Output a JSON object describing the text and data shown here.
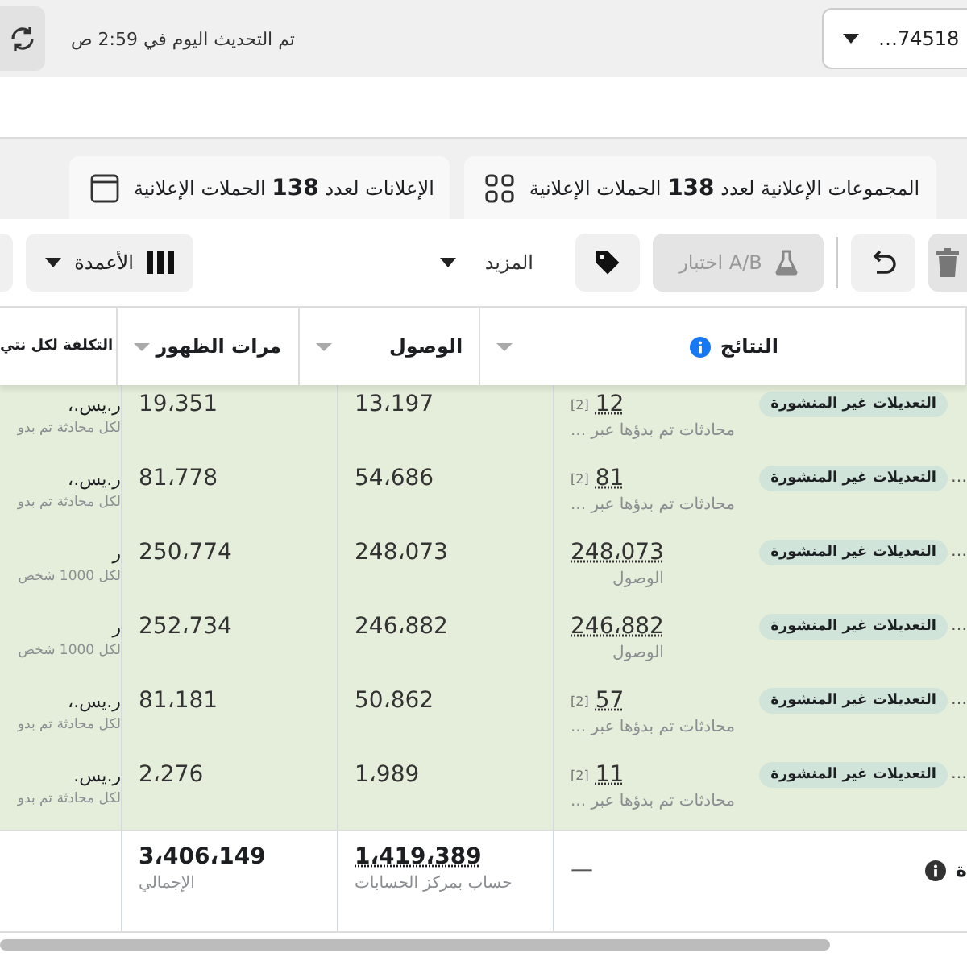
{
  "topbar": {
    "updated": "تم التحديث اليوم في 2:59 ص",
    "account": "…74518"
  },
  "tabs": [
    {
      "label": "المجموعات الإعلانية لعدد **138** الحملات الإعلانية",
      "kind": "grid",
      "selected": false
    },
    {
      "label": "الإعلانات لعدد **138** الحملات الإعلانية",
      "kind": "window",
      "selected": false
    }
  ],
  "toolbar": {
    "columns": "الأعمدة",
    "more": "المزيد",
    "ab_test": {
      "label": "اختبار A/B",
      "disabled": true
    }
  },
  "table": {
    "columns": [
      {
        "label": "النتائج",
        "info": true
      },
      {
        "label": "الوصول",
        "info": false
      },
      {
        "label": "مرات الظهور",
        "info": false
      },
      {
        "label": "التكلفة لكل نتي",
        "info": false
      }
    ],
    "rows": [
      {
        "cost": "ر.يس.،",
        "cost_sub": "لكل محادثة تم بدو",
        "impressions": "19،351",
        "reach": "13،197",
        "result": "12",
        "note": "[2]",
        "result_sub": "محادثات تم بدؤها عبر ...",
        "badge": "التعديلات غير المنشورة",
        "name": ""
      },
      {
        "cost": "ر.يس.،",
        "cost_sub": "لكل محادثة تم بدو",
        "impressions": "81،778",
        "reach": "54،686",
        "result": "81",
        "note": "[2]",
        "result_sub": "محادثات تم بدؤها عبر ...",
        "badge": "التعديلات غير المنشورة",
        "name": "…"
      },
      {
        "cost": "ر",
        "cost_sub": "لكل 1000 شخص",
        "impressions": "250،774",
        "reach": "248،073",
        "result": "248،073",
        "note": "",
        "result_sub": "الوصول",
        "badge": "التعديلات غير المنشورة",
        "name": "…"
      },
      {
        "cost": "ر",
        "cost_sub": "لكل 1000 شخص",
        "impressions": "252،734",
        "reach": "246،882",
        "result": "246،882",
        "note": "",
        "result_sub": "الوصول",
        "badge": "التعديلات غير المنشورة",
        "name": "…"
      },
      {
        "cost": "ر.يس.،",
        "cost_sub": "لكل محادثة تم بدو",
        "impressions": "81،181",
        "reach": "50،862",
        "result": "57",
        "note": "[2]",
        "result_sub": "محادثات تم بدؤها عبر ...",
        "badge": "التعديلات غير المنشورة",
        "name": "…"
      },
      {
        "cost": "ر.يس.",
        "cost_sub": "لكل محادثة تم بدو",
        "impressions": "2،276",
        "reach": "1،989",
        "result": "11",
        "note": "[2]",
        "result_sub": "محادثات تم بدؤها عبر ...",
        "badge": "التعديلات غير المنشورة",
        "name": "…"
      }
    ],
    "totals": {
      "impressions": "3،406،149",
      "impressions_sub": "الإجمالي",
      "reach": "1،419،389",
      "reach_sub": "حساب بمركز الحسابات",
      "results": "—",
      "label": "ة"
    }
  }
}
